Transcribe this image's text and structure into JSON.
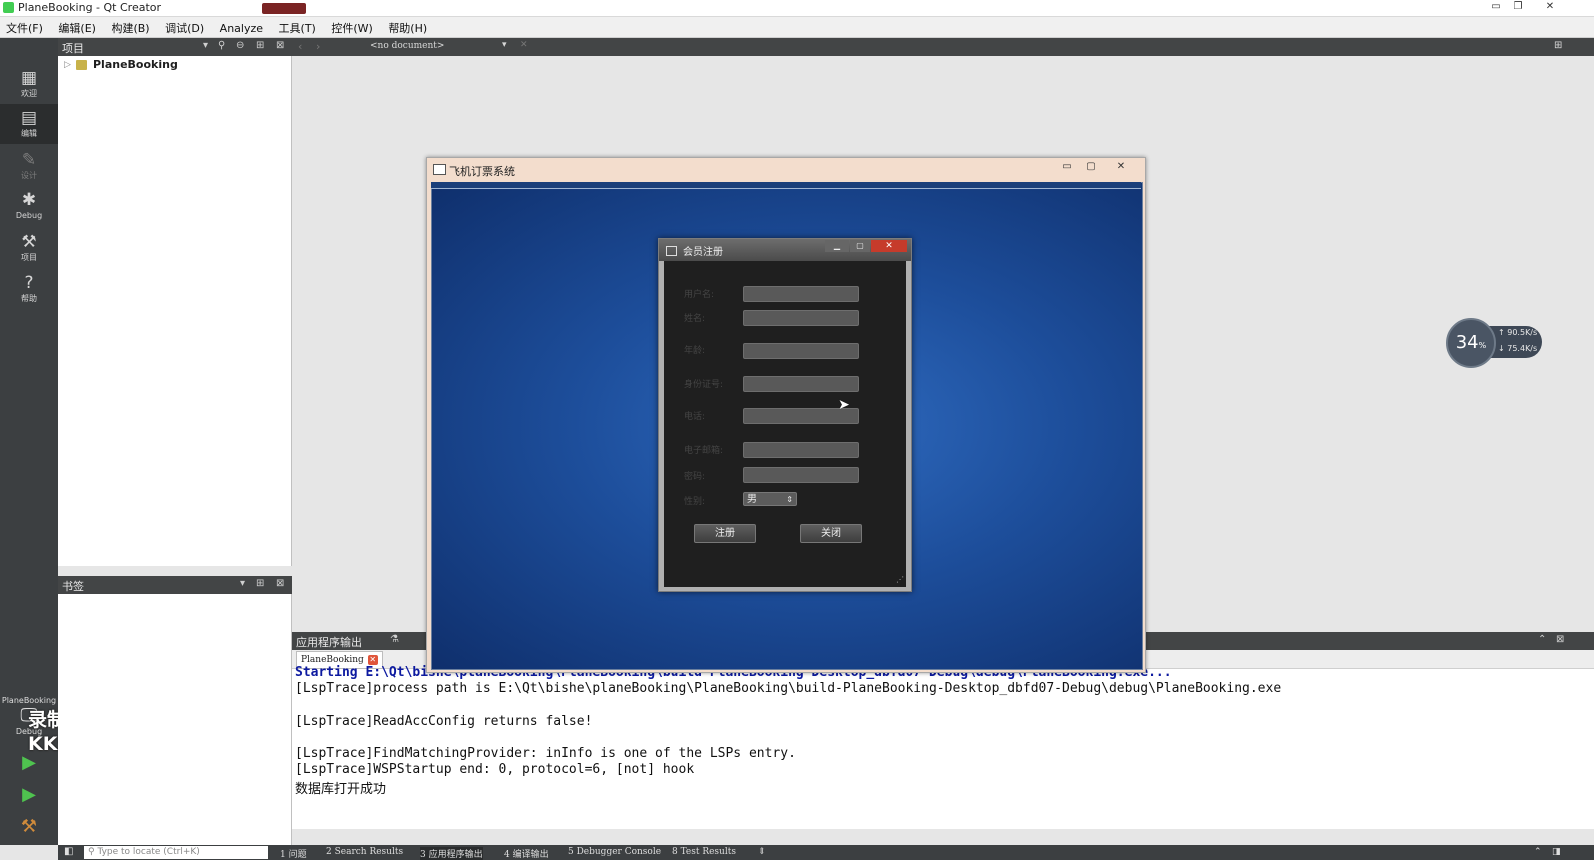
{
  "window": {
    "title": "PlaneBooking - Qt Creator"
  },
  "menu": [
    "文件(F)",
    "编辑(E)",
    "构建(B)",
    "调试(D)",
    "Analyze",
    "工具(T)",
    "控件(W)",
    "帮助(H)"
  ],
  "modes": [
    {
      "label": "欢迎",
      "icon": "grid-icon"
    },
    {
      "label": "编辑",
      "icon": "edit-icon"
    },
    {
      "label": "设计",
      "icon": "pencil-icon"
    },
    {
      "label": "Debug",
      "icon": "bug-icon"
    },
    {
      "label": "项目",
      "icon": "wrench-icon"
    },
    {
      "label": "帮助",
      "icon": "help-icon"
    }
  ],
  "kit": {
    "project": "PlaneBooking",
    "mode": "Debug"
  },
  "projects_panel": {
    "title": "项目",
    "root": "PlaneBooking"
  },
  "bookmarks_panel": {
    "title": "书签"
  },
  "editor": {
    "document": "<no document>"
  },
  "output": {
    "title": "应用程序输出",
    "tab": "PlaneBooking",
    "lines": [
      "Starting E:\\Qt\\bishe\\planeBooking\\PlaneBooking\\build-PlaneBooking-Desktop_dbfd07-Debug\\debug\\PlaneBooking.exe...",
      "[LspTrace]process path is E:\\Qt\\bishe\\planeBooking\\PlaneBooking\\build-PlaneBooking-Desktop_dbfd07-Debug\\debug\\PlaneBooking.exe",
      "",
      "[LspTrace]ReadAccConfig returns false!",
      "",
      "[LspTrace]FindMatchingProvider: inInfo is one of the LSPs entry.",
      "[LspTrace]WSPStartup end: 0, protocol=6, [not] hook",
      "数据库打开成功"
    ]
  },
  "status": {
    "locate_placeholder": "Type to locate (Ctrl+K)",
    "tabs": [
      "1 问题",
      "2 Search Results",
      "3 应用程序输出",
      "4 编译输出",
      "5 Debugger Console",
      "8 Test Results"
    ]
  },
  "app_window": {
    "title": "飞机订票系统"
  },
  "dialog": {
    "title": "会员注册",
    "fields": [
      "用户名:",
      "姓名:",
      "年龄:",
      "身份证号:",
      "电话:",
      "电子邮箱:",
      "密码:",
      "性别:"
    ],
    "gender": "男",
    "register_btn": "注册",
    "close_btn": "关闭"
  },
  "netmon": {
    "percent": "34",
    "unit": "%",
    "up": "90.5",
    "up_unit": "K/s",
    "down": "75.4",
    "down_unit": "K/s"
  },
  "watermark": {
    "line1": "录制工具",
    "line2": "KK录像机"
  }
}
